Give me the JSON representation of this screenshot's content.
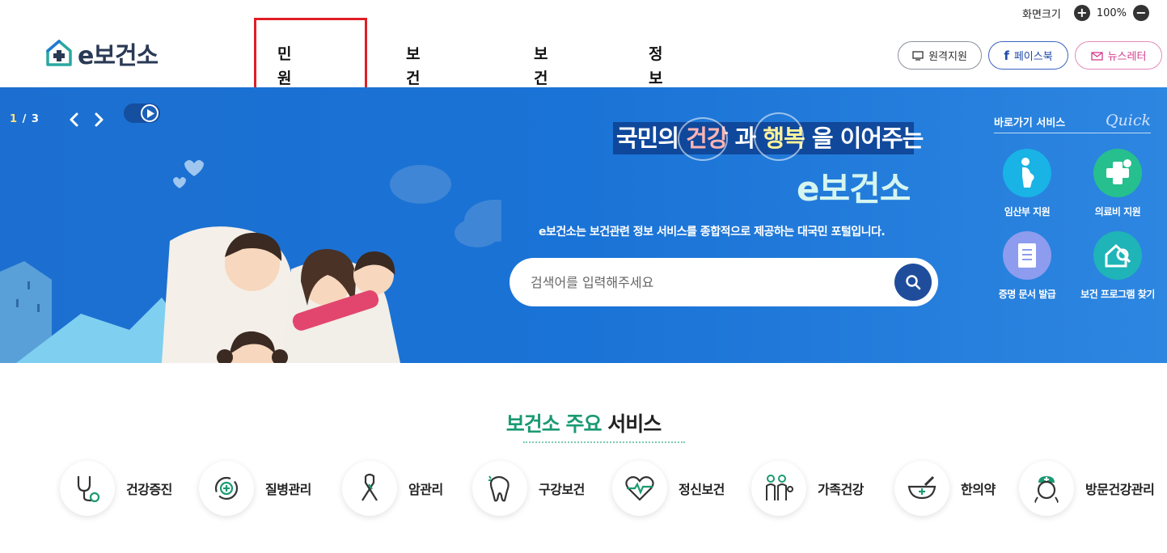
{
  "zoom": {
    "label": "화면크기",
    "value": "100%",
    "plus": "+",
    "minus": "−"
  },
  "logo": {
    "text": "e보건소"
  },
  "gnb": {
    "items": [
      "민원서비스",
      "보건서비스",
      "보건소식",
      "정보·알림"
    ]
  },
  "quick_links": {
    "remote": "원격지원",
    "facebook": "페이스북",
    "newsletter": "뉴스레터",
    "fb_glyph": "f"
  },
  "banner": {
    "counter_current": "1",
    "counter_sep": "/",
    "counter_total": "3",
    "title_part1": "국민의 ",
    "title_hl1": "건강",
    "title_part2": " 과 ",
    "title_hl2": "행복",
    "title_part3": " 을 이어주는",
    "brand": "e보건소",
    "description": "e보건소는 보건관련 정보 서비스를 종합적으로 제공하는 대국민 포털입니다.",
    "search_placeholder": "검색어를 입력해주세요"
  },
  "quick_panel": {
    "title": "바로가기 서비스",
    "script": "Quick",
    "items": [
      "임산부 지원",
      "의료비 지원",
      "증명 문서 발급",
      "보건 프로그램 찾기"
    ]
  },
  "services": {
    "title_green": "보건소 주요",
    "title_rest": " 서비스",
    "items": [
      "건강증진",
      "질병관리",
      "암관리",
      "구강보건",
      "정신보건",
      "가족건강",
      "한의약",
      "방문건강관리"
    ]
  },
  "colors": {
    "brand_blue": "#1a73d6",
    "accent_green": "#1b9a72",
    "highlight_red": "#e01e25"
  }
}
